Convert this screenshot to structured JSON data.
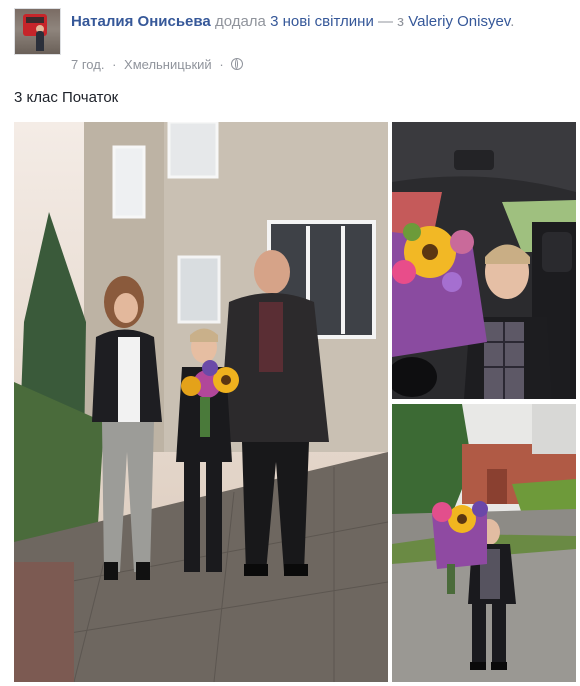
{
  "post": {
    "author": "Наталия Онисьева",
    "action_prefix": "додала",
    "photos_link": "3 нові світлини",
    "with_text": "— з",
    "tagged_user": "Valeriy Onisyev",
    "tagged_suffix": ".",
    "time": "7 год.",
    "separator": "·",
    "location": "Хмельницький",
    "caption": "3 клас Початок",
    "privacy_icon": "globe-icon"
  },
  "photos": [
    {
      "name": "family-photo",
      "description_icon": "image"
    },
    {
      "name": "car-photo",
      "description_icon": "image"
    },
    {
      "name": "yard-photo",
      "description_icon": "image"
    }
  ],
  "colors": {
    "link": "#365899",
    "meta": "#90949c",
    "text": "#1d2129"
  }
}
